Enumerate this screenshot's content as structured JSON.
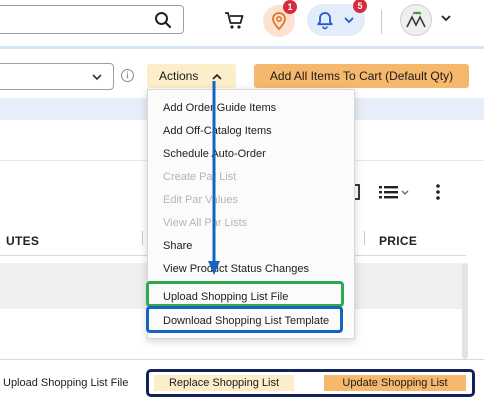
{
  "header": {
    "search": {
      "value": "",
      "placeholder": ""
    },
    "notifications": {
      "pin_badge": "1",
      "bell_badge": "5"
    }
  },
  "toolbar": {
    "select_value": "",
    "actions_label": "Actions",
    "add_all_label": "Add All Items To Cart (Default Qty)"
  },
  "actions_menu": {
    "items": [
      {
        "label": "Add Order Guide Items",
        "enabled": true
      },
      {
        "label": "Add Off-Catalog Items",
        "enabled": true
      },
      {
        "label": "Schedule Auto-Order",
        "enabled": true
      },
      {
        "label": "Create Par List",
        "enabled": false
      },
      {
        "label": "Edit Par Values",
        "enabled": false
      },
      {
        "label": "View All Par Lists",
        "enabled": false
      },
      {
        "label": "Share",
        "enabled": true
      },
      {
        "label": "View Product Status Changes",
        "enabled": true
      },
      {
        "label": "Upload Shopping List File",
        "enabled": true
      },
      {
        "label": "Download Shopping List Template",
        "enabled": true
      }
    ]
  },
  "table": {
    "columns": [
      "UTES",
      "PRICE"
    ]
  },
  "upload_panel": {
    "label": "Upload Shopping List File",
    "replace_label": "Replace Shopping List",
    "update_label": "Update Shopping List"
  },
  "colors": {
    "actions_bg": "#fbeec8",
    "primary_bg": "#f6b86d",
    "badge": "#d92a3d",
    "highlight_green": "#2fa84f",
    "highlight_blue": "#1565c0",
    "frame_navy": "#14225a"
  }
}
